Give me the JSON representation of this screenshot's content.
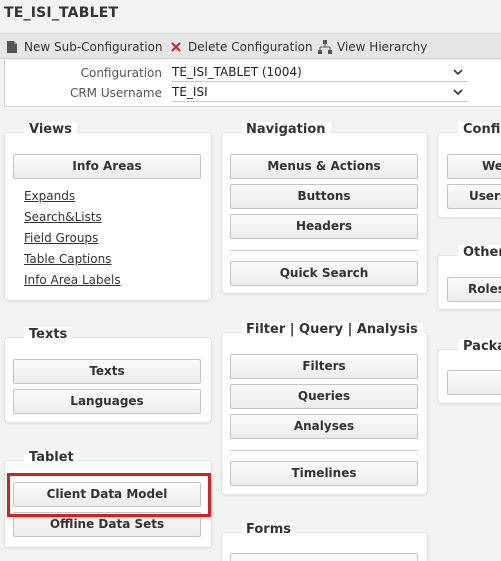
{
  "window": {
    "title": "TE_ISI_TABLET"
  },
  "toolbar": {
    "new_sub_label": "New Sub-Configuration",
    "delete_label": "Delete Configuration",
    "hierarchy_label": "View Hierarchy"
  },
  "config_form": {
    "configuration_label": "Configuration",
    "configuration_value": "TE_ISI_TABLET (1004)",
    "crm_label": "CRM Username",
    "crm_value": "TE_ISI"
  },
  "views": {
    "title": "Views",
    "info_areas_button": "Info Areas",
    "links": [
      "Expands",
      "Search&Lists",
      "Field Groups",
      "Table Captions",
      "Info Area Labels"
    ]
  },
  "navigation": {
    "title": "Navigation",
    "buttons": [
      "Menus & Actions",
      "Buttons",
      "Headers"
    ],
    "quick_search": "Quick Search"
  },
  "config_group": {
    "title": "Config",
    "buttons": [
      "We",
      "Users"
    ]
  },
  "texts": {
    "title": "Texts",
    "buttons": [
      "Texts",
      "Languages"
    ]
  },
  "filter": {
    "title": "Filter | Query | Analysis",
    "buttons": [
      "Filters",
      "Queries",
      "Analyses"
    ],
    "timelines": "Timelines"
  },
  "other": {
    "title": "Other",
    "buttons": [
      "Roles"
    ]
  },
  "packages": {
    "title": "Packa",
    "buttons": [
      ""
    ]
  },
  "tablet": {
    "title": "Tablet",
    "buttons": [
      "Client Data Model",
      "Offline Data Sets"
    ]
  },
  "forms": {
    "title": "Forms"
  },
  "colors": {
    "highlight": "#d42020",
    "delete_icon": "#d42020"
  }
}
